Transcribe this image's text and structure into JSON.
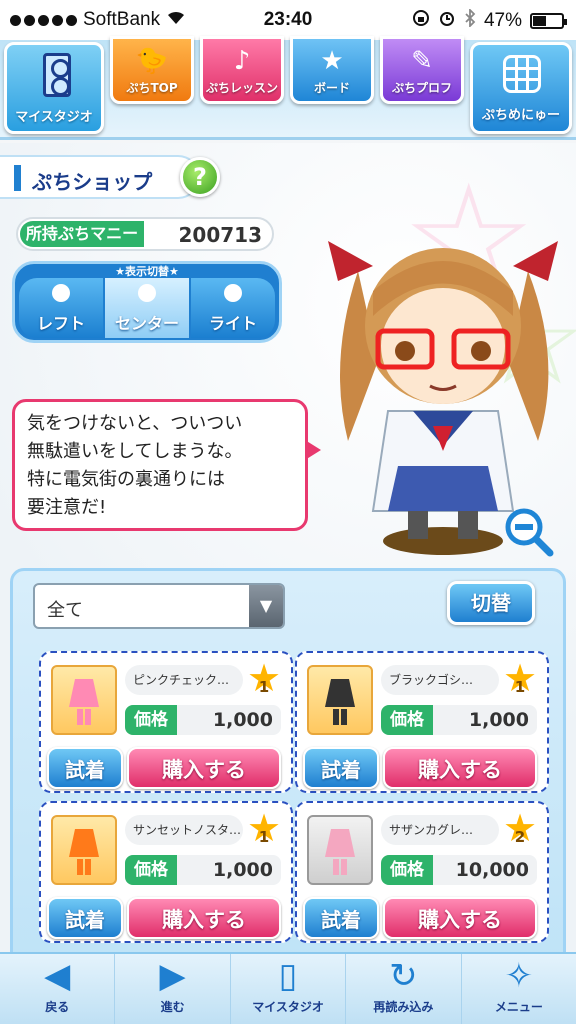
{
  "status": {
    "carrier": "SoftBank",
    "time": "23:40",
    "battery": "47%",
    "battery_level": 0.47
  },
  "topnav": {
    "studio_label": "マイスタジオ",
    "tabs": [
      {
        "label": "ぷちTOP",
        "icon": "bird-icon"
      },
      {
        "label": "ぷちレッスン",
        "icon": "music-note-icon"
      },
      {
        "label": "ボード",
        "icon": "star-icon"
      },
      {
        "label": "ぷちプロフ",
        "icon": "notebook-icon"
      }
    ],
    "menu_label": "ぷちめにゅー"
  },
  "shop": {
    "title": "ぷちショップ",
    "help_label": "?",
    "money_label": "所持ぷちマニー",
    "money_value": "200713"
  },
  "view_switch": {
    "caption": "★表示切替★",
    "left": "レフト",
    "center": "センター",
    "right": "ライト"
  },
  "speech": {
    "text": "気をつけないと、ついつい\n無駄遣いをしてしまうな。\n特に電気街の裏通りには\n要注意だ!"
  },
  "panel": {
    "filter_value": "全て",
    "switch_label": "切替",
    "items": [
      {
        "name": "ピンクチェック…",
        "rank": "1",
        "price_label": "価格",
        "price": "1,000",
        "try_label": "試着",
        "buy_label": "購入する",
        "color": "#ff8ab4"
      },
      {
        "name": "ブラックゴシ…",
        "rank": "1",
        "price_label": "価格",
        "price": "1,000",
        "try_label": "試着",
        "buy_label": "購入する",
        "color": "#333333"
      },
      {
        "name": "サンセットノスタ…",
        "rank": "1",
        "price_label": "価格",
        "price": "1,000",
        "try_label": "試着",
        "buy_label": "購入する",
        "color": "#ff7a1a"
      },
      {
        "name": "サザンカグレ…",
        "rank": "2",
        "price_label": "価格",
        "price": "10,000",
        "try_label": "試着",
        "buy_label": "購入する",
        "color": "#f4a7c0"
      }
    ]
  },
  "bottombar": {
    "back": "戻る",
    "forward": "進む",
    "studio": "マイスタジオ",
    "reload": "再読み込み",
    "menu": "メニュー"
  }
}
